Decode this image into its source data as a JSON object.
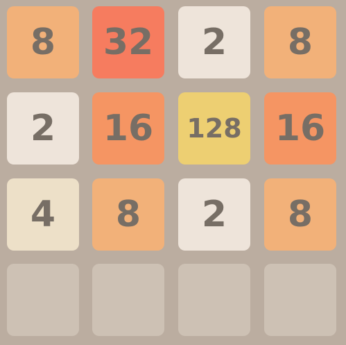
{
  "grid": [
    [
      8,
      32,
      2,
      8
    ],
    [
      2,
      16,
      128,
      16
    ],
    [
      4,
      8,
      2,
      8
    ],
    [
      null,
      null,
      null,
      null
    ]
  ],
  "colors": {
    "board": "#bbada0",
    "empty": "#cdc1b4",
    "text": "#776e65",
    "t2": "#eee4da",
    "t4": "#ede0c8",
    "t8": "#f2b179",
    "t16": "#f59563",
    "t32": "#f67c5f",
    "t128": "#edcf72"
  }
}
